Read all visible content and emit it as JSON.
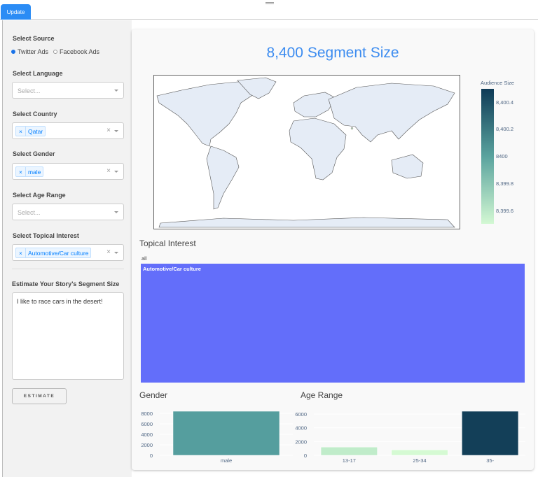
{
  "topbar": {
    "update_label": "Update"
  },
  "sidebar": {
    "source": {
      "label": "Select Source",
      "options": [
        {
          "label": "Twitter Ads",
          "selected": true
        },
        {
          "label": "Facebook Ads",
          "selected": false
        }
      ]
    },
    "language": {
      "label": "Select Language",
      "placeholder": "Select..."
    },
    "country": {
      "label": "Select Country",
      "selected": "Qatar"
    },
    "gender": {
      "label": "Select Gender",
      "selected": "male"
    },
    "age": {
      "label": "Select Age Range",
      "placeholder": "Select..."
    },
    "interest": {
      "label": "Select Topical Interest",
      "selected": "Automotive/Car culture"
    },
    "estimate": {
      "label": "Estimate Your Story's Segment Size",
      "text": "I like to race cars in the desert!",
      "button": "ESTIMATE"
    }
  },
  "main": {
    "title": "8,400 Segment Size",
    "map": {
      "colorbar_title": "Audience Size",
      "colorbar_ticks": [
        "8,400.4",
        "8,400.2",
        "8400",
        "8,399.8",
        "8,399.6"
      ],
      "colors": [
        "#d3f8d3",
        "#5aa39e",
        "#0f3b57"
      ],
      "highlighted_country": "Qatar"
    },
    "treemap": {
      "title": "Topical Interest",
      "root": "all",
      "tile": "Automotive/Car culture",
      "color": "#636efa"
    }
  },
  "chart_data": [
    {
      "type": "bar",
      "title": "Gender",
      "categories": [
        "male"
      ],
      "values": [
        8400
      ],
      "yticks": [
        "0",
        "2000",
        "4000",
        "6000",
        "8000"
      ],
      "ylim": [
        0,
        8400
      ],
      "colors": [
        "#559e9e"
      ]
    },
    {
      "type": "bar",
      "title": "Age Range",
      "categories": [
        "13-17",
        "25-34",
        "35-"
      ],
      "values": [
        1200,
        800,
        6400
      ],
      "yticks": [
        "0",
        "2000",
        "4000",
        "6000"
      ],
      "ylim": [
        0,
        6400
      ],
      "colors": [
        "#c0ecca",
        "#d5fad3",
        "#133f58"
      ]
    }
  ]
}
